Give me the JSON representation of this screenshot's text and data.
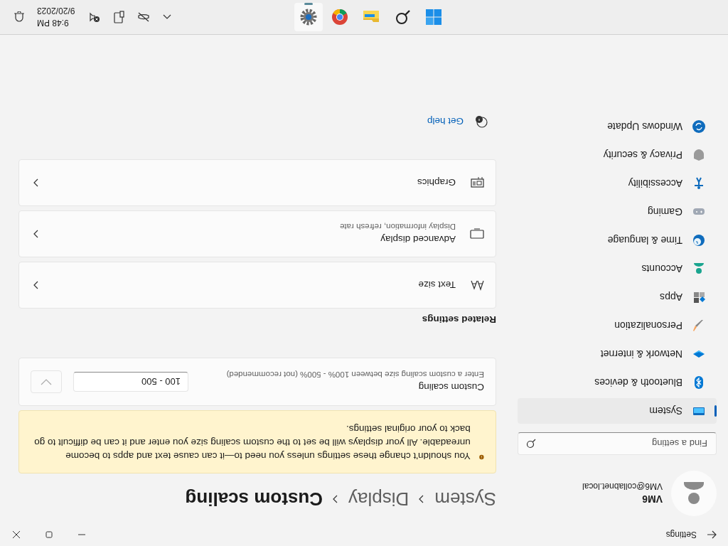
{
  "window": {
    "title": "Settings"
  },
  "user": {
    "name": "VM6",
    "email": "VM6@collabnet.local"
  },
  "search": {
    "placeholder": "Find a setting"
  },
  "nav": [
    {
      "label": "System",
      "selected": true
    },
    {
      "label": "Bluetooth & devices",
      "selected": false
    },
    {
      "label": "Network & internet",
      "selected": false
    },
    {
      "label": "Personalization",
      "selected": false
    },
    {
      "label": "Apps",
      "selected": false
    },
    {
      "label": "Accounts",
      "selected": false
    },
    {
      "label": "Time & language",
      "selected": false
    },
    {
      "label": "Gaming",
      "selected": false
    },
    {
      "label": "Accessibility",
      "selected": false
    },
    {
      "label": "Privacy & security",
      "selected": false
    },
    {
      "label": "Windows Update",
      "selected": false
    }
  ],
  "breadcrumb": [
    "System",
    "Display",
    "Custom scaling"
  ],
  "warning": "You shouldn't change these settings unless you need to—it can cause text and apps to become unreadable. All your displays will be set to the custom scaling size you enter and it can be difficult to go back to your original settings.",
  "custom_scaling": {
    "title": "Custom scaling",
    "description": "Enter a custom scaling size between 100% - 500% (not recommended)",
    "placeholder": "100 - 500",
    "apply_disabled": true
  },
  "related_settings": {
    "heading": "Related settings",
    "items": [
      {
        "title": "Text size"
      },
      {
        "title": "Advanced display",
        "subtitle": "Display information, refresh rate"
      },
      {
        "title": "Graphics"
      }
    ]
  },
  "get_help": "Get help",
  "taskbar": {
    "apps": [
      {
        "selected": false
      },
      {
        "selected": false
      },
      {
        "selected": false
      },
      {
        "selected": false
      },
      {
        "selected": true
      }
    ],
    "time": "9:48 PM",
    "date": "9/20/2023"
  }
}
